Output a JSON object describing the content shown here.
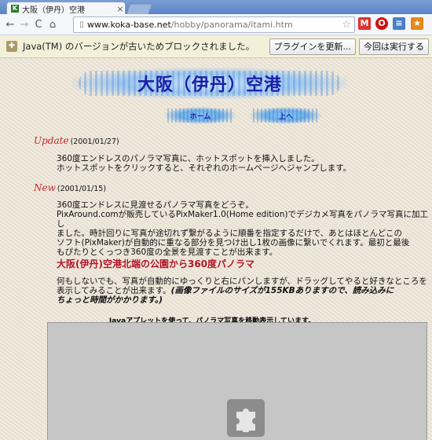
{
  "browser": {
    "tab_title": "大阪（伊丹）空港",
    "tab_close": "×",
    "favicon_letter": "K",
    "url_host": "www.koka-base.net",
    "url_path": "/hobby/panorama/itami.htm",
    "back_icon": "back-arrow-icon",
    "forward_icon": "forward-arrow-icon",
    "reload_icon": "reload-icon",
    "home_icon": "home-icon",
    "star_icon": "bookmark-star-icon"
  },
  "infobar": {
    "message": "Java(TM) のバージョンが古いためブロックされました。",
    "update_button": "プラグインを更新...",
    "run_button": "今回は実行する"
  },
  "page": {
    "site_title": "大阪（伊丹）空港",
    "nav_home": "ホーム",
    "nav_up": "上へ",
    "update_label": "Update",
    "update_date": "(2001/01/27)",
    "update_lines": [
      "360度エンドレスのパノラマ写真に、ホットスポットを挿入しました。",
      "ホットスポットをクリックすると、それぞれのホームページへジャンプします。"
    ],
    "new_label": "New",
    "new_date": "(2001/01/15)",
    "new_lines": [
      "360度エンドレスに見渡せるパノラマ写真をどうぞ。",
      "PixAround.comが販売しているPixMaker1.0(Home edition)でデジカメ写真をパノラマ写真に加工し",
      "ました。時計回りに写真が途切れず繋がるように順番を指定するだけで、あとはほとんどこの",
      "ソフト(PixMaker)が自動的に重なる部分を見つけ出し1枚の画像に繋いでくれます。最初と最後",
      "もぴたりとくっつき360度の全景を見渡すことが出来ます。"
    ],
    "section_heading": "大阪(伊丹)空港北端の公園から360度パノラマ",
    "desc_line1": "何もしないでも、写真が自動的にゆっくりと右にパンしますが、ドラッグしてやると好きなところを",
    "desc_line2_normal": "表示してみることが出来ます。",
    "desc_line2_bold": "(画像ファイルのサイズが155KBありますので、読み込みに",
    "desc_line3_bold": "ちょっと時間がかかります。)",
    "applet_caption": "Javaアプレットを使って、パノラマ写真を移動表示しています。"
  },
  "colors": {
    "title_blue": "#1a1fa6",
    "update_red": "#c8282d",
    "heading_red": "#b3152a",
    "page_bg": "#efe7d9"
  }
}
